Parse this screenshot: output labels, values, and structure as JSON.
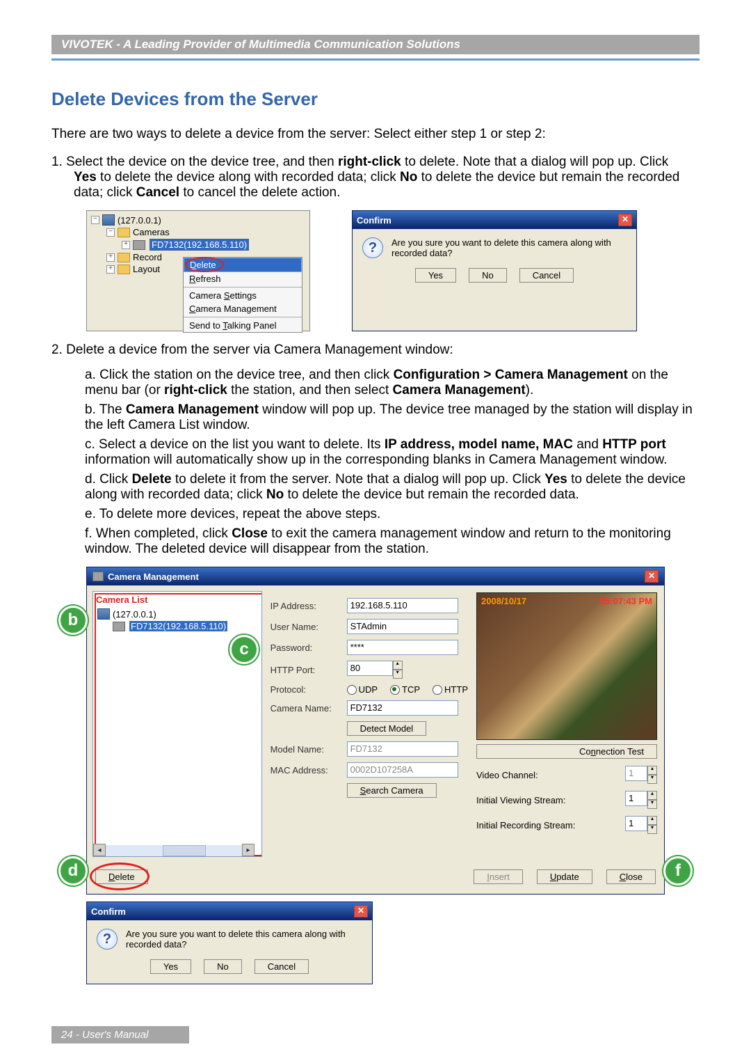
{
  "header": {
    "title": "VIVOTEK - A Leading Provider of Multimedia Communication Solutions"
  },
  "section": {
    "title": "Delete Devices from the Server",
    "intro": "There are two ways to delete a device from the server: Select either step 1 or step 2:",
    "step1_a": "1. Select the device on the device tree, and then ",
    "step1_b": "right-click",
    "step1_c": " to delete. Note that a dialog will pop up. Click ",
    "step1_yes": "Yes",
    "step1_d": " to delete the device along with recorded data; click ",
    "step1_no": "No",
    "step1_e": " to delete the device but remain the recorded data; click ",
    "step1_cancel": "Cancel",
    "step1_f": " to cancel the delete action.",
    "step2": "2. Delete a device from the server via Camera Management window:",
    "sa1": "a. Click the station on the device tree, and then click ",
    "sa1b": "Configuration > Camera Management",
    "sa1c": " on the menu bar (or ",
    "sa1d": "right-click",
    "sa1e": " the station, and then select ",
    "sa1f": "Camera Management",
    "sa1g": ").",
    "sb1": "b. The ",
    "sb1b": "Camera Management",
    "sb1c": " window will pop up. The device tree managed by the station will display in the left Camera List window.",
    "sc1": "c. Select a device on the list you want to delete. Its ",
    "sc1b": "IP address, model name, MAC",
    "sc1c": " and ",
    "sc1d": "HTTP port",
    "sc1e": " information will automatically show up in the corresponding blanks in Camera Management window.",
    "sd1": "d. Click ",
    "sd1b": "Delete",
    "sd1c": " to delete it from the server. Note that a dialog will pop up. Click ",
    "sd1d": "Yes",
    "sd1e": " to delete the device along with recorded data; click ",
    "sd1f": "No",
    "sd1g": " to delete the device but remain the recorded data.",
    "se": "e. To delete more devices, repeat the above steps.",
    "sf1": "f. When completed, click ",
    "sf1b": "Close",
    "sf1c": " to exit the camera management window and return to the monitoring window. The deleted device will disappear from the station."
  },
  "tree": {
    "root_ip": "(127.0.0.1)",
    "cameras_label": "Cameras",
    "device_label": "FD7132(192.168.5.110)",
    "record_label": "Record",
    "layout_label": "Layout"
  },
  "context_menu": {
    "delete": "Delete",
    "refresh": "Refresh",
    "camera_settings": "Camera Settings",
    "camera_management": "Camera Management",
    "send_talking": "Send to Talking Panel",
    "delete_accel": "D",
    "refresh_accel": "R",
    "settings_accel": "S",
    "management_accel": "C",
    "talking_accel": "T"
  },
  "confirm": {
    "title": "Confirm",
    "message": "Are you sure you want to delete this camera along with recorded data?",
    "yes": "Yes",
    "no": "No",
    "cancel": "Cancel"
  },
  "cm": {
    "title": "Camera Management",
    "camera_list_label": "Camera List",
    "station_ip": "(127.0.0.1)",
    "cam_item": "FD7132(192.168.5.110)",
    "labels": {
      "ip": "IP Address:",
      "user": "User Name:",
      "password": "Password:",
      "httpport": "HTTP Port:",
      "protocol": "Protocol:",
      "camera_name": "Camera Name:",
      "detect_model": "Detect Model",
      "model_name": "Model Name:",
      "mac": "MAC Address:",
      "search_camera": "Search Camera",
      "video_channel": "Video Channel:",
      "init_view": "Initial Viewing Stream:",
      "init_record": "Initial Recording Stream:",
      "conn_test": "Connection Test"
    },
    "values": {
      "ip": "192.168.5.110",
      "user": "STAdmin",
      "password": "****",
      "httpport": "80",
      "camera_name": "FD7132",
      "model_name": "FD7132",
      "mac": "0002D107258A",
      "video_channel": "1",
      "init_view": "1",
      "init_record": "1"
    },
    "protocol": {
      "udp": "UDP",
      "tcp": "TCP",
      "http": "HTTP"
    },
    "osd": {
      "date": "2008/10/17",
      "time": "05:07:43 PM"
    },
    "buttons": {
      "delete": "Delete",
      "insert": "Insert",
      "update": "Update",
      "close": "Close"
    },
    "delete_accel": "D",
    "insert_accel": "I",
    "update_accel": "U",
    "close_accel": "C",
    "search_accel": "S",
    "conn_accel": "n"
  },
  "badges": {
    "b": "b",
    "c": "c",
    "d": "d",
    "f": "f"
  },
  "footer": {
    "text": "24 - User's Manual"
  }
}
